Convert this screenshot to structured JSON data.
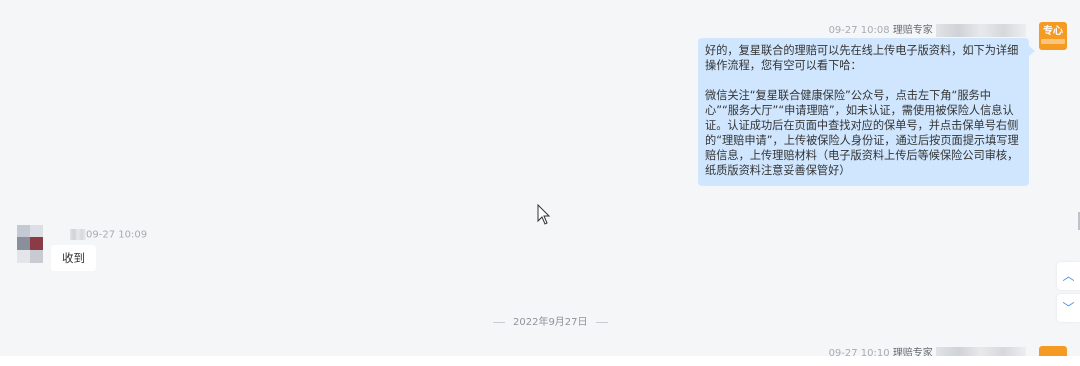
{
  "messages": {
    "outgoing1": {
      "time": "09-27 10:08",
      "sender": "理赔专家",
      "paragraph1": "好的，复星联合的理赔可以先在线上传电子版资料，如下为详细操作流程，您有空可以看下哈：",
      "paragraph2": "微信关注“复星联合健康保险”公众号，点击左下角“服务中心”“服务大厅”“申请理赔”，如未认证，需使用被保险人信息认证。认证成功后在页面中查找对应的保单号，并点击保单号右侧的“理赔申请”，上传被保险人身份证，通过后按页面提示填写理赔信息，上传理赔材料（电子版资料上传后等候保险公司审核，纸质版资料注意妥善保管好）",
      "avatar_text": "专心"
    },
    "incoming1": {
      "time": "09-27 10:09",
      "text": "收到"
    },
    "outgoing2": {
      "time": "09-27 10:10",
      "sender": "理赔专家"
    }
  },
  "date_divider": "2022年9月27日",
  "scroll": {
    "up_icon": "chevron-up-icon",
    "down_icon": "chevron-down-icon",
    "up_glyph": "︿",
    "down_glyph": "﹀"
  },
  "colors": {
    "chat_bg": "#f5f6f8",
    "outgoing_bubble": "#cfe6fe",
    "incoming_bubble": "#ffffff",
    "agent_avatar": "#f59a23",
    "scroll_icon": "#4a90e2"
  }
}
